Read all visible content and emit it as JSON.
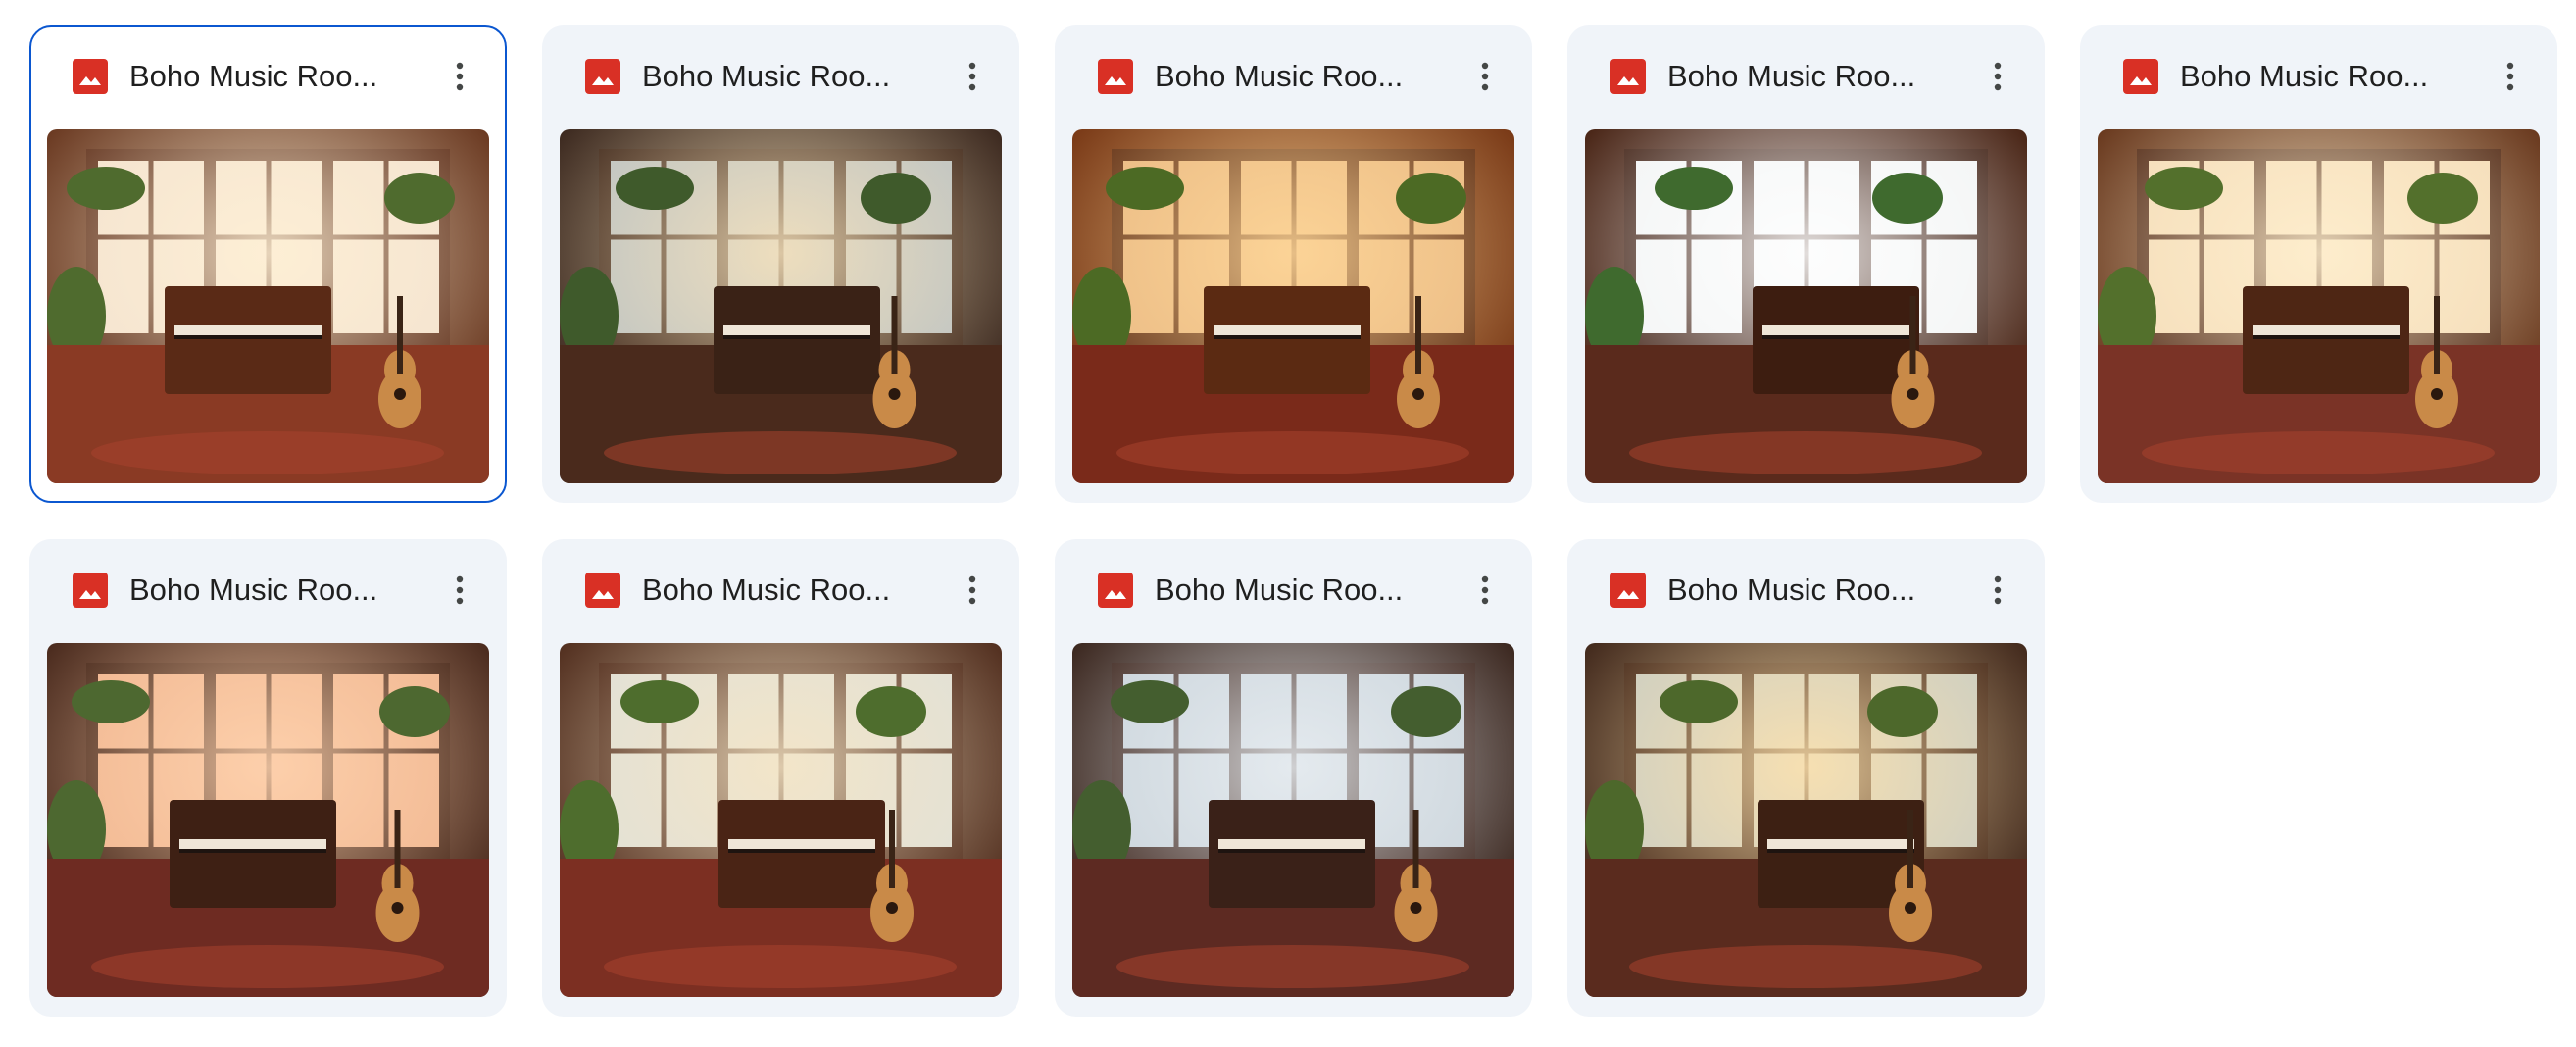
{
  "colors": {
    "accent": "#0b57d0",
    "image_icon": "#d93025",
    "card_bg": "#f0f4f9"
  },
  "files": [
    {
      "name": "Boho Music Roo...",
      "icon": "image-file-icon",
      "selected": true,
      "scene": "warm"
    },
    {
      "name": "Boho Music Roo...",
      "icon": "image-file-icon",
      "selected": false,
      "scene": "cool"
    },
    {
      "name": "Boho Music Roo...",
      "icon": "image-file-icon",
      "selected": false,
      "scene": "orange"
    },
    {
      "name": "Boho Music Roo...",
      "icon": "image-file-icon",
      "selected": false,
      "scene": "bright"
    },
    {
      "name": "Boho Music Roo...",
      "icon": "image-file-icon",
      "selected": false,
      "scene": "golden"
    },
    {
      "name": "Boho Music Roo...",
      "icon": "image-file-icon",
      "selected": false,
      "scene": "sunset"
    },
    {
      "name": "Boho Music Roo...",
      "icon": "image-file-icon",
      "selected": false,
      "scene": "cozy"
    },
    {
      "name": "Boho Music Roo...",
      "icon": "image-file-icon",
      "selected": false,
      "scene": "dusk"
    },
    {
      "name": "Boho Music Roo...",
      "icon": "image-file-icon",
      "selected": false,
      "scene": "lamp"
    }
  ]
}
